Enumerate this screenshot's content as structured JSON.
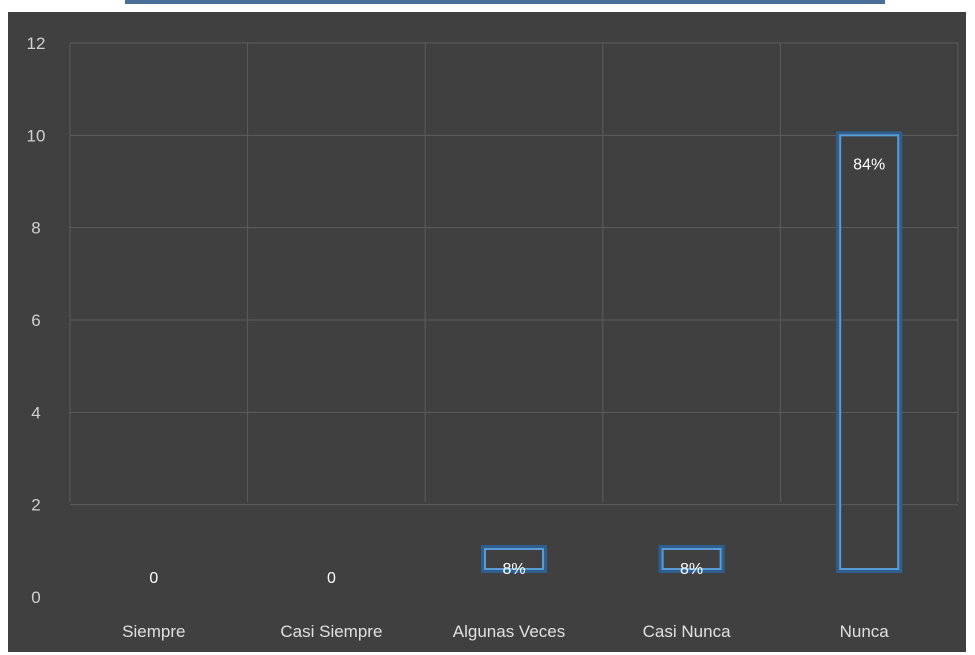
{
  "chart_data": {
    "type": "bar",
    "categories": [
      "Siempre",
      "Casi Siempre",
      "Algunas Veces",
      "Casi Nunca",
      "Nunca"
    ],
    "values": [
      0,
      0,
      1,
      1,
      10
    ],
    "data_labels": [
      "0",
      "0",
      "8%",
      "8%",
      "84%"
    ],
    "yticks": [
      "0",
      "2",
      "4",
      "6",
      "8",
      "10",
      "12"
    ],
    "ylim": [
      0,
      12
    ],
    "grid": true,
    "colors": {
      "background": "#404040",
      "gridline": "#5c5c5c",
      "bar_stroke": "#5b9bd5",
      "bar_glow": "#2f5f8f"
    }
  }
}
